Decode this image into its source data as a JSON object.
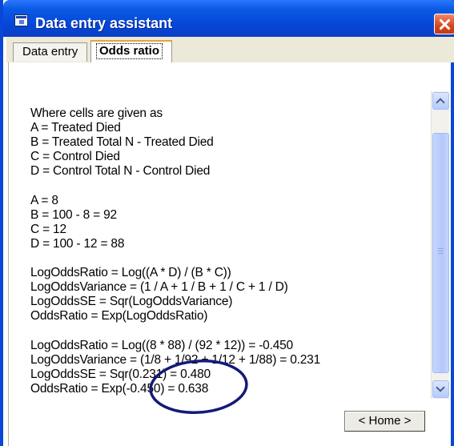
{
  "window": {
    "title": "Data entry assistant",
    "icon": "app-window-icon",
    "close_icon": "close-icon"
  },
  "tabs": [
    {
      "label": "Data entry",
      "selected": false
    },
    {
      "label": "Odds ratio",
      "selected": true
    }
  ],
  "content": {
    "lines": [
      "Where cells are given as",
      "A = Treated Died",
      "B = Treated Total N  - Treated Died",
      "C = Control Died",
      "D = Control Total N  - Control Died",
      "",
      "A = 8",
      "B = 100 - 8 = 92",
      "C = 12",
      "D = 100 - 12 = 88",
      "",
      "LogOddsRatio = Log((A * D) / (B * C))",
      "LogOddsVariance = (1 / A + 1 / B + 1 / C + 1 / D)",
      "LogOddsSE = Sqr(LogOddsVariance)",
      "OddsRatio = Exp(LogOddsRatio)",
      "",
      "LogOddsRatio = Log((8 * 88) / (92 * 12)) = -0.450",
      "LogOddsVariance = (1/8 + 1/92 + 1/12 + 1/88) = 0.231",
      "LogOddsSE = Sqr(0.231) = 0.480",
      "OddsRatio = Exp(-0.450) = 0.638"
    ]
  },
  "buttons": {
    "home": "< Home >"
  },
  "annotation_color": "#141a78"
}
